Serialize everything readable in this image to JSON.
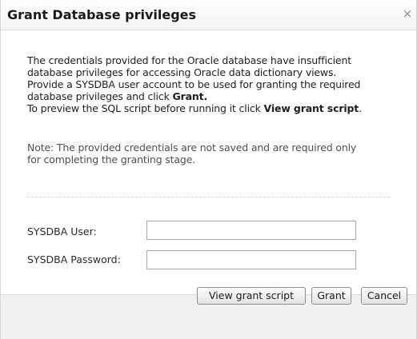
{
  "dialog": {
    "title": "Grant Database privileges",
    "close_label": "×"
  },
  "message": {
    "line1": "The credentials provided for the Oracle database have insufficient",
    "line2": "database privileges for accessing Oracle data dictionary views.",
    "line3": "Provide a SYSDBA user account to be used for granting the required",
    "line4_text": "database privileges and click ",
    "line4_bold": "Grant.",
    "line5_text": "To preview the SQL script before running it click ",
    "line5_bold": "View grant script",
    "line5_end": "."
  },
  "note": {
    "line1": "Note: The provided credentials are not saved and are required only",
    "line2": "for completing the granting stage."
  },
  "form": {
    "user_label": "SYSDBA User:",
    "user_value": "",
    "password_label": "SYSDBA Password:",
    "password_value": ""
  },
  "buttons": {
    "view_script": "View grant script",
    "grant": "Grant",
    "cancel": "Cancel"
  }
}
